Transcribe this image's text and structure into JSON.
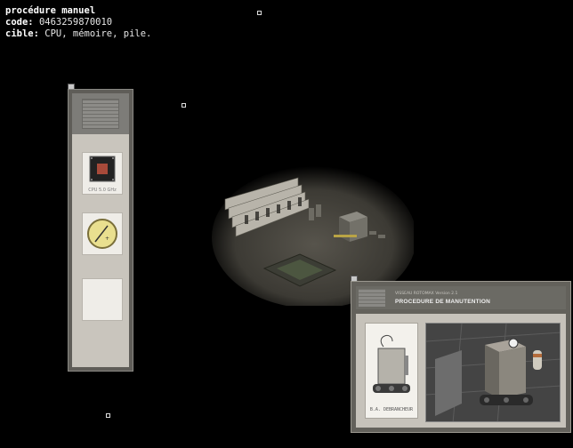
{
  "hud": {
    "procedure_label": "procédure manuel",
    "code_key": "code:",
    "code_value": "0463259870010",
    "target_key": "cible:",
    "target_value": "CPU, mémoire, pile."
  },
  "inventory": {
    "chip_label": "CPU 5.0 GHz",
    "dial_icon": "gauge-dial-icon",
    "empty_slot": ""
  },
  "procedure_panel": {
    "version": "VISSEAU ROTOMAX Version 2.1",
    "title": "PROCEDURE DE MANUTENTION",
    "card_label": "B.A. DEBRANCHEUR"
  },
  "colors": {
    "background": "#000000",
    "panel": "#5f5d58",
    "panel_inner": "#c9c5bd"
  }
}
